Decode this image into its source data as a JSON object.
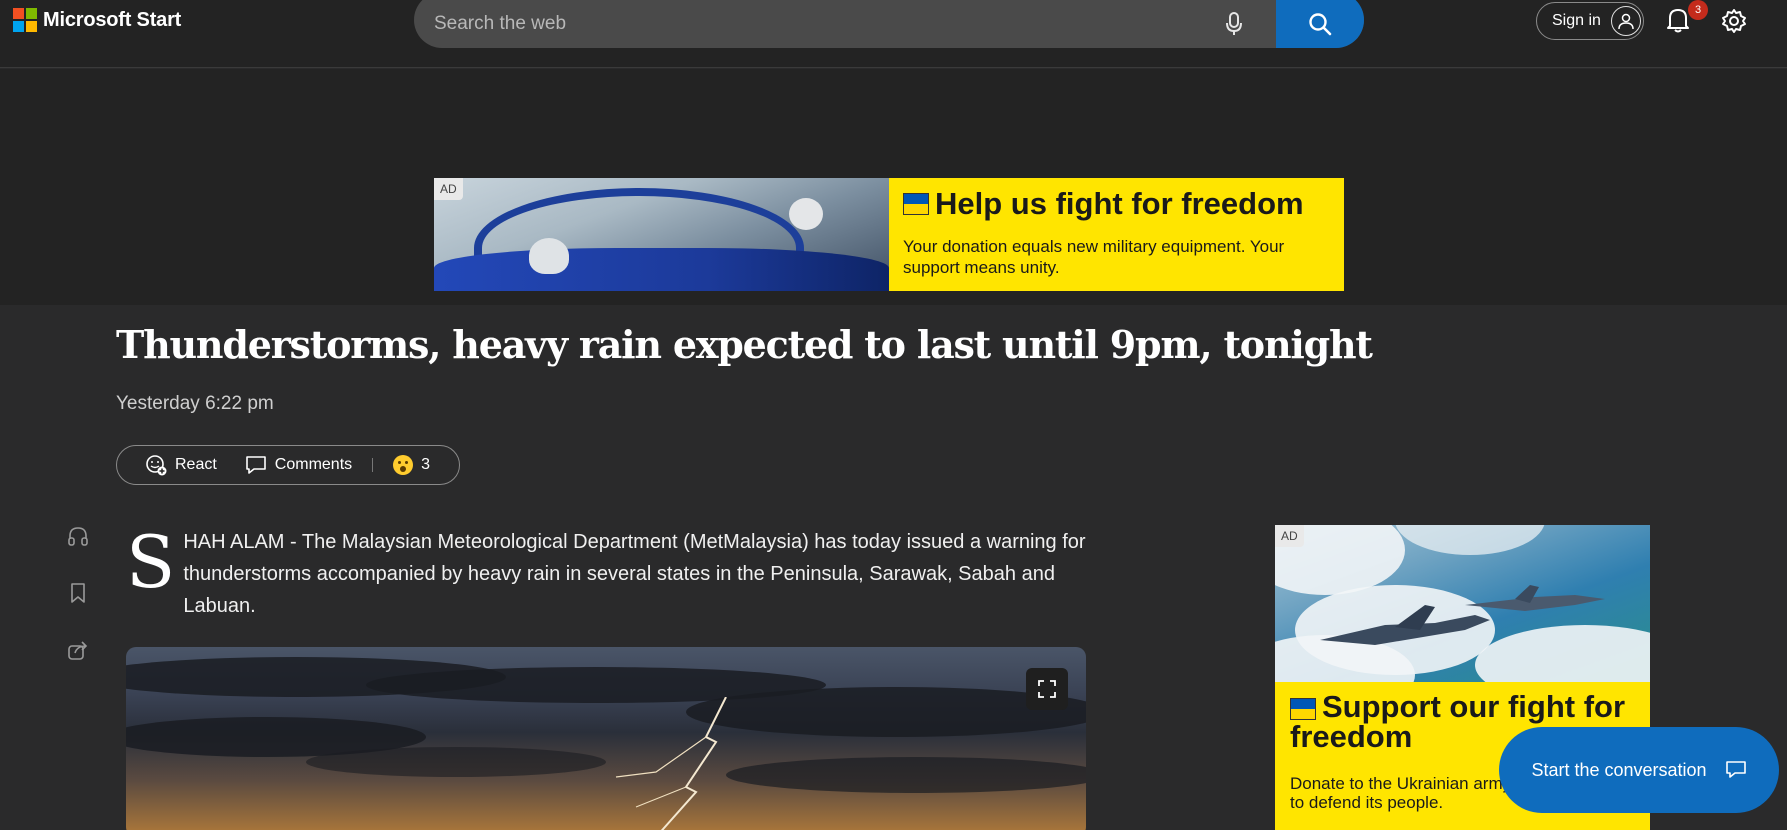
{
  "header": {
    "brand": "Microsoft Start",
    "search_placeholder": "Search the web",
    "signin_label": "Sign in",
    "notification_count": "3"
  },
  "top_ad": {
    "tag": "AD",
    "title": "Help us fight for freedom",
    "text": "Your donation equals new military equipment. Your support means unity."
  },
  "article": {
    "headline": "Thunderstorms, heavy rain expected to last until 9pm, tonight",
    "date": "Yesterday 6:22 pm",
    "react_label": "React",
    "comments_label": "Comments",
    "reaction_count": "3",
    "dropcap": "S",
    "lead": "HAH ALAM - The Malaysian Meteorological Department (MetMalaysia) has today issued a warning for thunderstorms accompanied by heavy rain in several states in the Peninsula, Sarawak, Sabah and Labuan."
  },
  "right_ad": {
    "tag": "AD",
    "title": "Support our fight for freedom",
    "text": "Donate to the Ukrainian army. Help Ukraine to defend its people."
  },
  "chat": {
    "label": "Start the conversation"
  },
  "colors": {
    "accent": "#0f6cbd",
    "ad_yellow": "#ffe500",
    "badge": "#c42b1c"
  }
}
